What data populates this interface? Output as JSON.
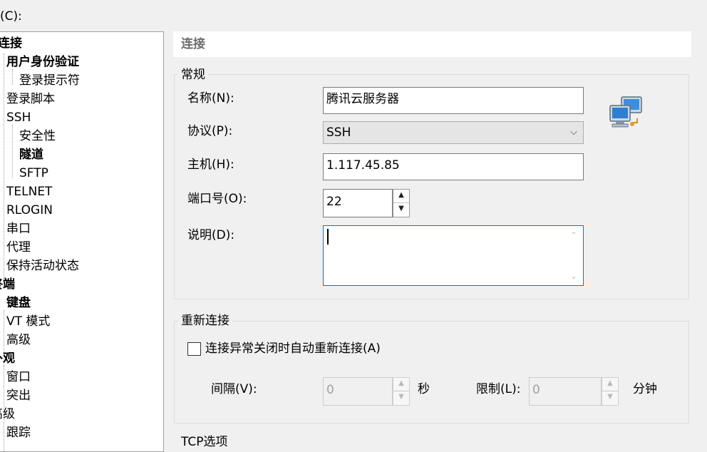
{
  "top_label": "(C):",
  "tree": {
    "items": [
      {
        "label": "连接",
        "bold": true
      },
      {
        "label": "用户身份验证",
        "bold": true
      },
      {
        "label": "登录提示符",
        "bold": false
      },
      {
        "label": "登录脚本",
        "bold": false
      },
      {
        "label": "SSH",
        "bold": false
      },
      {
        "label": "安全性",
        "bold": false
      },
      {
        "label": "隧道",
        "bold": true
      },
      {
        "label": "SFTP",
        "bold": false
      },
      {
        "label": "TELNET",
        "bold": false
      },
      {
        "label": "RLOGIN",
        "bold": false
      },
      {
        "label": "串口",
        "bold": false
      },
      {
        "label": "代理",
        "bold": false
      },
      {
        "label": "保持活动状态",
        "bold": false
      },
      {
        "label": "终端",
        "bold": true
      },
      {
        "label": "键盘",
        "bold": true
      },
      {
        "label": "VT 模式",
        "bold": false
      },
      {
        "label": "高级",
        "bold": false
      },
      {
        "label": "外观",
        "bold": true
      },
      {
        "label": "窗口",
        "bold": false
      },
      {
        "label": "突出",
        "bold": false
      },
      {
        "label": "高级",
        "bold": false
      },
      {
        "label": "跟踪",
        "bold": false
      }
    ]
  },
  "panel": {
    "title": "连接",
    "general": {
      "group_label": "常规",
      "name_label": "名称(N):",
      "name_value": "腾讯云服务器",
      "protocol_label": "协议(P):",
      "protocol_value": "SSH",
      "host_label": "主机(H):",
      "host_value": "1.117.45.85",
      "port_label": "端口号(O):",
      "port_value": "22",
      "desc_label": "说明(D):",
      "desc_value": ""
    },
    "reconnect": {
      "group_label": "重新连接",
      "checkbox_label": "连接异常关闭时自动重新连接(A)",
      "checked": false,
      "interval_label": "间隔(V):",
      "interval_value": "0",
      "interval_unit": "秒",
      "limit_label": "限制(L):",
      "limit_value": "0",
      "limit_unit": "分钟"
    },
    "tcp": {
      "group_label": "TCP选项"
    }
  },
  "icons": {
    "session": "network-computers-icon"
  },
  "colors": {
    "focus_border": "#0078d7",
    "window_bg": "#f0f0f0"
  }
}
